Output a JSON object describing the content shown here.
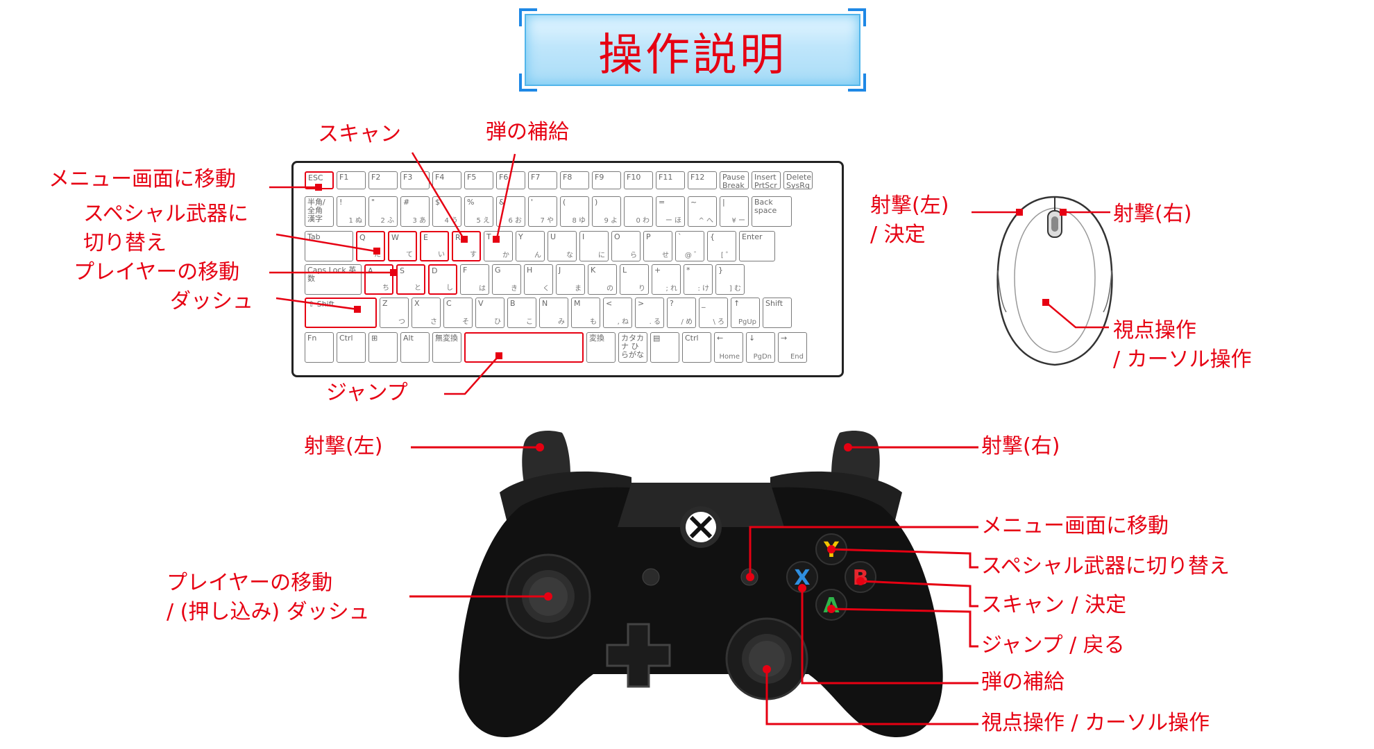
{
  "title": "操作説明",
  "keyboard": {
    "labels": {
      "scan": "スキャン",
      "reload": "弾の補給",
      "menu": "メニュー画面に移動",
      "special_1": "スペシャル武器に",
      "special_2": "切り替え",
      "move": "プレイヤーの移動",
      "dash": "ダッシュ",
      "jump": "ジャンプ"
    },
    "row_fn": [
      "ESC",
      "F1",
      "F2",
      "F3",
      "F4",
      "F5",
      "F6",
      "F7",
      "F8",
      "F9",
      "F10",
      "F11",
      "F12",
      "Pause Break",
      "Insert PrtScr",
      "Delete SysRq"
    ],
    "row_num": [
      [
        "半角/全角 漢字",
        ""
      ],
      [
        "!",
        "1 ぬ"
      ],
      [
        "\"",
        "2 ふ"
      ],
      [
        "#",
        "3 あ"
      ],
      [
        "$",
        "4 う"
      ],
      [
        "%",
        "5 え"
      ],
      [
        "&",
        "6 お"
      ],
      [
        "'",
        "7 や"
      ],
      [
        "(",
        "8 ゆ"
      ],
      [
        ")",
        "9 よ"
      ],
      [
        "",
        "0 わ"
      ],
      [
        "=",
        "ー ほ"
      ],
      [
        "~",
        "^ へ"
      ],
      [
        "|",
        "¥ ー"
      ],
      [
        "Back space",
        ""
      ]
    ],
    "row_q": [
      [
        "Tab",
        ""
      ],
      [
        "Q",
        "た"
      ],
      [
        "W",
        "て"
      ],
      [
        "E",
        "い"
      ],
      [
        "R",
        "す"
      ],
      [
        "T",
        "か"
      ],
      [
        "Y",
        "ん"
      ],
      [
        "U",
        "な"
      ],
      [
        "I",
        "に"
      ],
      [
        "O",
        "ら"
      ],
      [
        "P",
        "せ"
      ],
      [
        "`",
        "@ ゛"
      ],
      [
        "{",
        "[ ゜"
      ],
      [
        "Enter",
        ""
      ]
    ],
    "row_a": [
      [
        "Caps Lock 英数",
        ""
      ],
      [
        "A",
        "ち"
      ],
      [
        "S",
        "と"
      ],
      [
        "D",
        "し"
      ],
      [
        "F",
        "は"
      ],
      [
        "G",
        "き"
      ],
      [
        "H",
        "く"
      ],
      [
        "J",
        "ま"
      ],
      [
        "K",
        "の"
      ],
      [
        "L",
        "り"
      ],
      [
        "+",
        "; れ"
      ],
      [
        "*",
        ": け"
      ],
      [
        "}",
        "] む"
      ]
    ],
    "row_z": [
      [
        "⇧ Shift",
        ""
      ],
      [
        "Z",
        "つ"
      ],
      [
        "X",
        "さ"
      ],
      [
        "C",
        "そ"
      ],
      [
        "V",
        "ひ"
      ],
      [
        "B",
        "こ"
      ],
      [
        "N",
        "み"
      ],
      [
        "M",
        "も"
      ],
      [
        "<",
        ", ね"
      ],
      [
        ">",
        ". る"
      ],
      [
        "?",
        "/ め"
      ],
      [
        "_",
        "\\ ろ"
      ],
      [
        "↑",
        "PgUp"
      ],
      [
        "Shift",
        ""
      ]
    ],
    "row_bottom": [
      [
        "Fn",
        ""
      ],
      [
        "Ctrl",
        ""
      ],
      [
        "⊞",
        ""
      ],
      [
        "Alt",
        ""
      ],
      [
        "無変換",
        ""
      ],
      [
        "",
        ""
      ],
      [
        "変換",
        ""
      ],
      [
        "カタカナ ひらがな",
        ""
      ],
      [
        "▤",
        ""
      ],
      [
        "Ctrl",
        ""
      ],
      [
        "←",
        "Home"
      ],
      [
        "↓",
        "PgDn"
      ],
      [
        "→",
        "End"
      ]
    ]
  },
  "mouse": {
    "left_1": "射撃(左)",
    "left_2": "/ 決定",
    "right": "射撃(右)",
    "body_1": "視点操作",
    "body_2": "/ カーソル操作"
  },
  "controller": {
    "lt": "射撃(左)",
    "rt": "射撃(右)",
    "menu": "メニュー画面に移動",
    "y": "スペシャル武器に切り替え",
    "b": "スキャン / 決定",
    "a": "ジャンプ / 戻る",
    "x": "弾の補給",
    "rstick": "視点操作 / カーソル操作",
    "lstick_1": "プレイヤーの移動",
    "lstick_2": "/ (押し込み) ダッシュ",
    "btn_y": "Y",
    "btn_b": "B",
    "btn_a": "A",
    "btn_x": "X"
  },
  "colors": {
    "accent": "#e60012",
    "btn_y": "#f2c500",
    "btn_b": "#e4262d",
    "btn_a": "#2fb34a",
    "btn_x": "#2f8fe0"
  }
}
